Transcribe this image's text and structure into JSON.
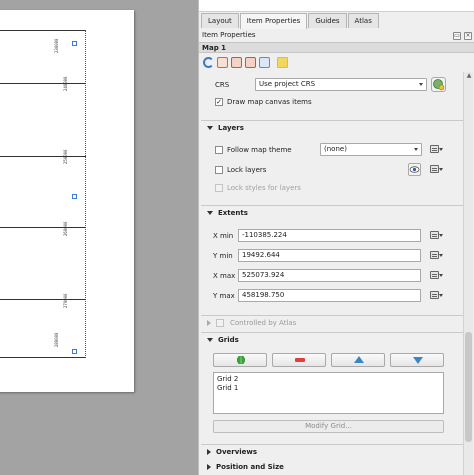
{
  "tabs": [
    {
      "label": "Layout",
      "active": false
    },
    {
      "label": "Item Properties",
      "active": true
    },
    {
      "label": "Guides",
      "active": false
    },
    {
      "label": "Atlas",
      "active": false
    }
  ],
  "dock": {
    "title": "Item Properties",
    "float_symbol": "▭",
    "close_symbol": "×"
  },
  "item": {
    "name": "Map 1"
  },
  "toolbar": {
    "icons": [
      "refresh-icon",
      "map-extent-icon",
      "set-extent-icon",
      "view-extent-icon",
      "zoom-to-item-icon",
      "labels-icon"
    ],
    "colors": [
      "#3a79c8",
      "#d3673a",
      "#cc5533",
      "#cc5533",
      "#5a8bd0",
      "#e2c02a"
    ]
  },
  "crs": {
    "label": "CRS",
    "value": "Use project CRS"
  },
  "draw_canvas_items": {
    "label": "Draw map canvas items",
    "checked": true,
    "check_symbol": "✓"
  },
  "layers": {
    "title": "Layers",
    "follow_theme": {
      "label": "Follow map theme",
      "checked": false
    },
    "theme_value": "(none)",
    "lock_layers": {
      "label": "Lock layers",
      "checked": false
    },
    "lock_styles": {
      "label": "Lock styles for layers",
      "checked": false
    }
  },
  "extents": {
    "title": "Extents",
    "fields": [
      {
        "label": "X min",
        "value": "-110385.224"
      },
      {
        "label": "Y min",
        "value": "19492.644"
      },
      {
        "label": "X max",
        "value": "525073.924"
      },
      {
        "label": "Y max",
        "value": "458198.750"
      }
    ]
  },
  "controlled_by_atlas": {
    "label": "Controlled by Atlas"
  },
  "grids": {
    "title": "Grids",
    "buttons": [
      {
        "name": "add-grid-button",
        "icon": "plus-icon",
        "color": "#3aa23a"
      },
      {
        "name": "remove-grid-button",
        "icon": "minus-icon",
        "color": "#e0403a"
      },
      {
        "name": "move-grid-up-button",
        "icon": "arrow-up-icon",
        "color": "#3d86c6"
      },
      {
        "name": "move-grid-down-button",
        "icon": "arrow-down-icon",
        "color": "#3d86c6"
      }
    ],
    "items": [
      "Grid 2",
      "Grid 1"
    ],
    "modify_label": "Modify Grid..."
  },
  "overviews": {
    "title": "Overviews"
  },
  "position_size": {
    "title": "Position and Size"
  },
  "canvas": {
    "coord_labels": [
      "230000",
      "240000",
      "250000",
      "260000",
      "270000",
      "280000"
    ]
  }
}
